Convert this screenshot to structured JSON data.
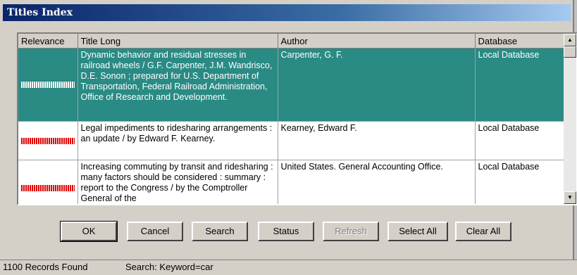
{
  "window": {
    "title": "Titles Index"
  },
  "grid": {
    "columns": [
      "Relevance",
      "Title Long",
      "Author",
      "Database"
    ],
    "rows": [
      {
        "relevance_bar": "white",
        "title": "Dynamic behavior and residual stresses in railroad wheels / G.F. Carpenter, J.M. Wandrisco, D.E. Sonon ; prepared for U.S. Department of Transportation, Federal Railroad Administration, Office of Research and Development.",
        "author": "Carpenter, G. F.",
        "database": "Local Database",
        "selected": true
      },
      {
        "relevance_bar": "red",
        "title": "Legal impediments to ridesharing arrangements : an update / by Edward F. Kearney.",
        "author": "Kearney, Edward F.",
        "database": "Local Database",
        "selected": false
      },
      {
        "relevance_bar": "red",
        "title": "Increasing commuting by transit and ridesharing : many factors should be considered : summary : report to the Congress / by the Comptroller General of the",
        "author": "United States. General Accounting Office.",
        "database": "Local Database",
        "selected": false
      }
    ]
  },
  "buttons": {
    "ok": "OK",
    "cancel": "Cancel",
    "search": "Search",
    "status": "Status",
    "refresh": "Refresh",
    "select_all": "Select All",
    "clear_all": "Clear All"
  },
  "statusbar": {
    "records": "1100 Records Found",
    "search": "Search: Keyword=car"
  },
  "colors": {
    "selected_row": "#2a8a84",
    "relevance_red": "#e00000",
    "titlebar": "#0a246a"
  }
}
